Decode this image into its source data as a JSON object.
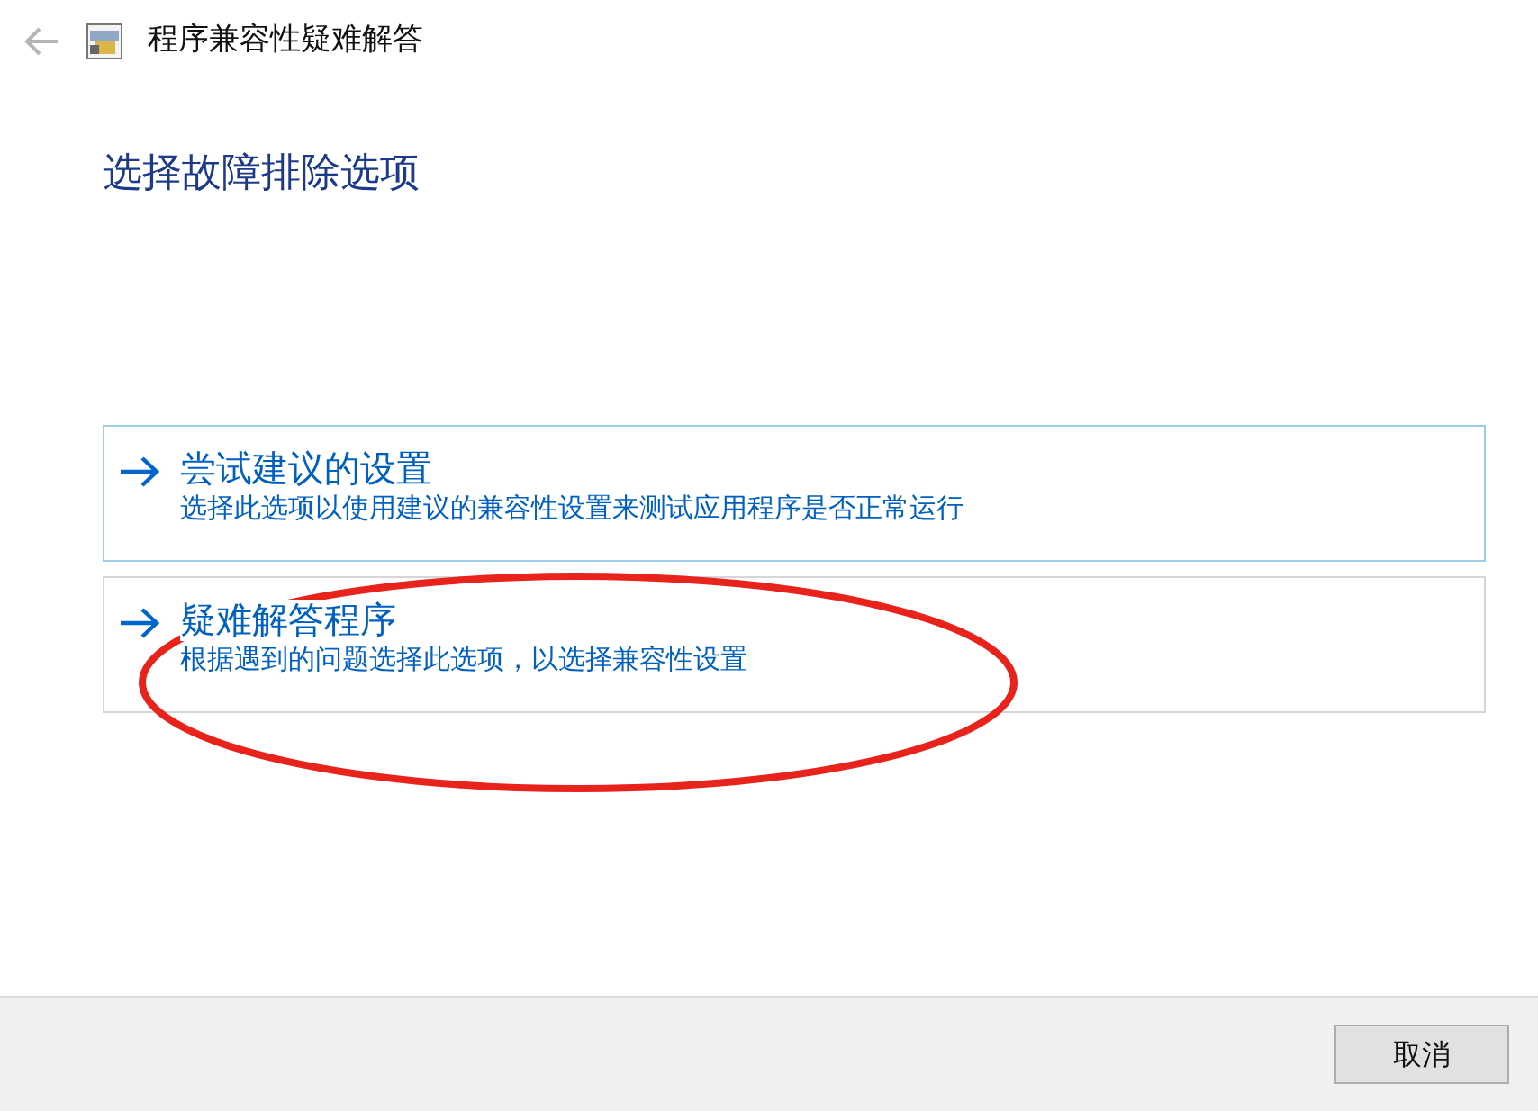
{
  "window": {
    "title": "程序兼容性疑难解答"
  },
  "heading": "选择故障排除选项",
  "options": [
    {
      "title": "尝试建议的设置",
      "description": "选择此选项以使用建议的兼容性设置来测试应用程序是否正常运行",
      "selected": true
    },
    {
      "title": "疑难解答程序",
      "description": "根据遇到的问题选择此选项，以选择兼容性设置",
      "selected": false
    }
  ],
  "annotation": {
    "kind": "ellipse",
    "color": "#e8231c"
  },
  "buttons": [
    "取消"
  ]
}
